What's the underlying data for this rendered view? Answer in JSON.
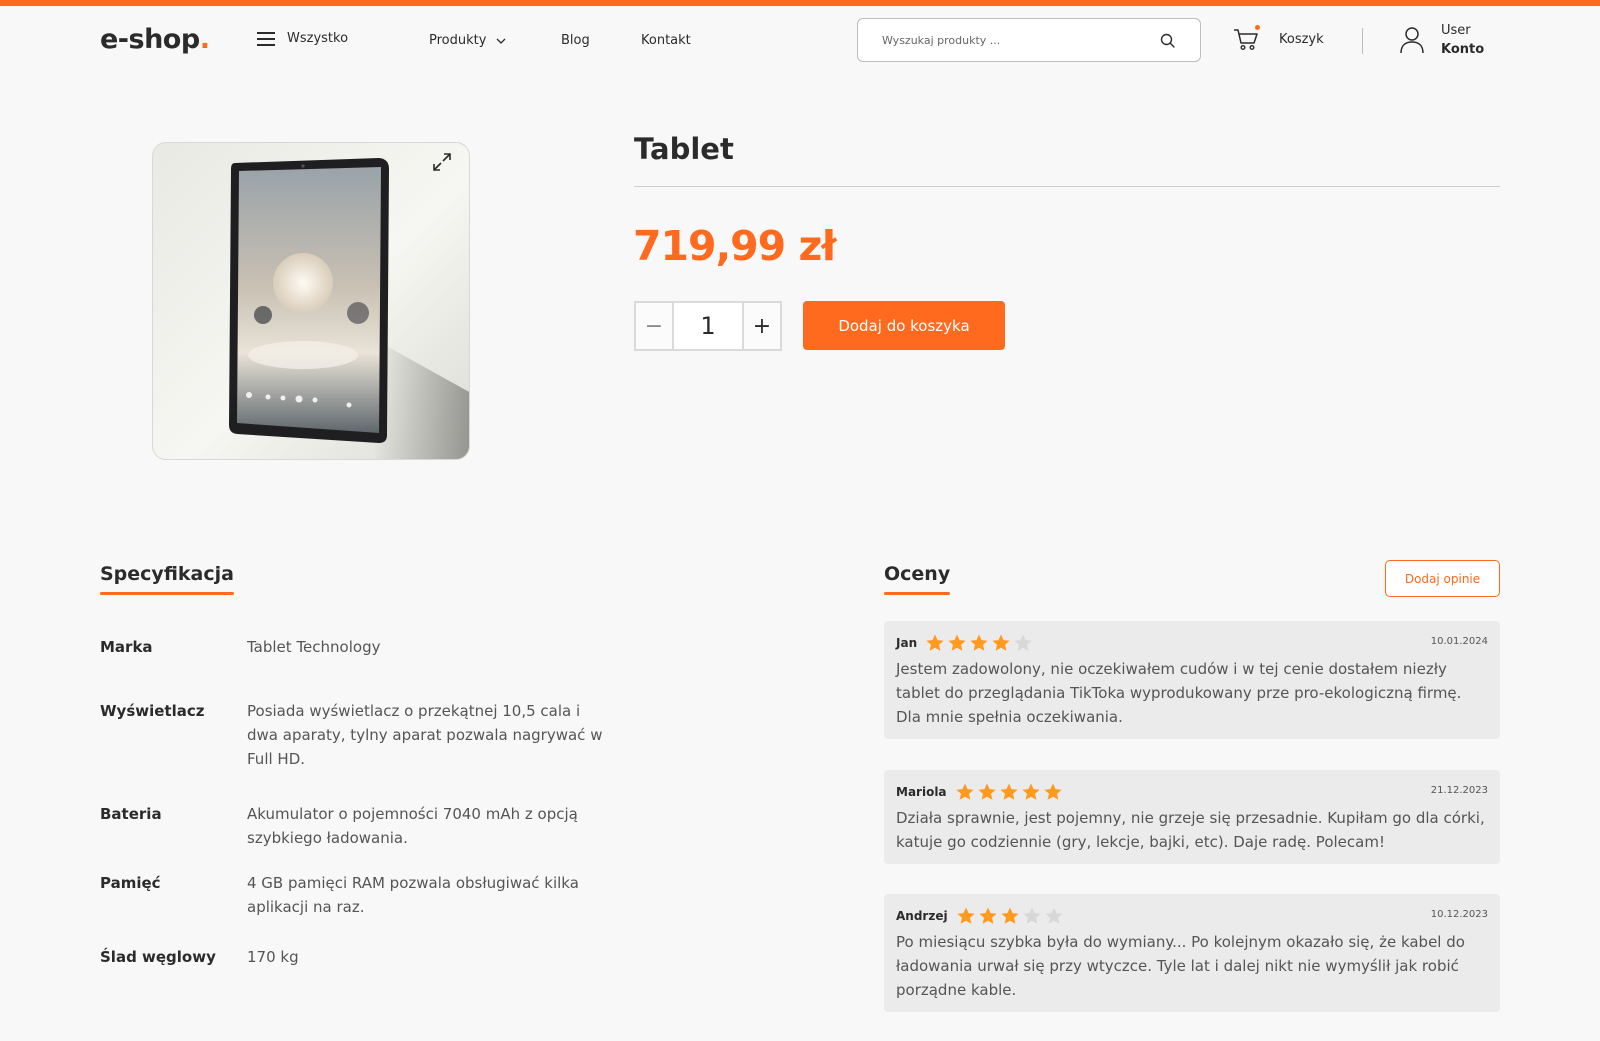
{
  "colors": {
    "accent": "#ff6a1f",
    "star_filled": "#ff9a1f",
    "star_empty": "#d8d8d8"
  },
  "header": {
    "logo_text": "e-shop",
    "logo_dot": ".",
    "all_label": "Wszystko",
    "nav": {
      "products": "Produkty",
      "blog": "Blog",
      "contact": "Kontakt"
    },
    "search_placeholder": "Wyszukaj produkty ...",
    "cart_label": "Koszyk",
    "account_line1": "User",
    "account_line2": "Konto"
  },
  "product": {
    "title": "Tablet",
    "price": "719,99 zł",
    "quantity": "1",
    "qty_minus": "−",
    "qty_plus": "+",
    "add_to_cart": "Dodaj do koszyka"
  },
  "specs": {
    "heading": "Specyfikacja",
    "items": [
      {
        "label": "Marka",
        "value": "Tablet Technology"
      },
      {
        "label": "Wyświetlacz",
        "value": "Posiada wyświetlacz o przekątnej 10,5 cala i dwa aparaty, tylny aparat pozwala nagrywać w Full HD."
      },
      {
        "label": "Bateria",
        "value": "Akumulator o pojemności 7040 mAh z opcją szybkiego ładowania."
      },
      {
        "label": "Pamięć",
        "value": "4 GB pamięci RAM pozwala obsługiwać kilka aplikacji na raz."
      },
      {
        "label": "Ślad węglowy",
        "value": "170 kg"
      }
    ]
  },
  "reviews": {
    "heading": "Oceny",
    "add_label": "Dodaj opinie",
    "items": [
      {
        "name": "Jan",
        "rating": 4,
        "date": "10.01.2024",
        "text": "Jestem zadowolony, nie oczekiwałem cudów i w tej cenie dostałem niezły tablet do przeglądania TikToka wyprodukowany prze pro-ekologiczną firmę. Dla mnie spełnia oczekiwania."
      },
      {
        "name": "Mariola",
        "rating": 5,
        "date": "21.12.2023",
        "text": "Działa sprawnie, jest pojemny, nie grzeje się przesadnie. Kupiłam go dla córki, katuje go codziennie (gry, lekcje, bajki, etc). Daje radę. Polecam!"
      },
      {
        "name": "Andrzej",
        "rating": 3,
        "date": "10.12.2023",
        "text": "Po miesiącu szybka była do wymiany... Po kolejnym okazało się, że kabel do ładowania urwał się przy wtyczce. Tyle lat i dalej nikt nie wymyślił jak robić porządne kable."
      }
    ]
  }
}
